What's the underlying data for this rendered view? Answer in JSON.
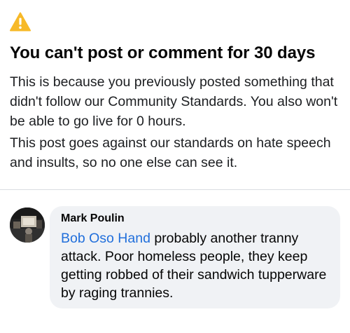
{
  "notice": {
    "icon": "warning-icon",
    "icon_color": "#f7b928",
    "title": "You can't post or comment for 30 days",
    "paragraph_1": "This is because you previously posted something that didn't follow our Community Standards.  You also won't be able to go  live for 0 hours.",
    "paragraph_2": "This post goes against our standards on hate speech and insults, so no one else can see it."
  },
  "comment": {
    "author": "Mark Poulin",
    "mention": "Bob Oso Hand",
    "mention_color": "#216fdb",
    "text": " probably another tranny attack. Poor homeless people, they keep getting robbed of their sandwich tupperware by raging trannies.",
    "avatar": "avatar"
  }
}
